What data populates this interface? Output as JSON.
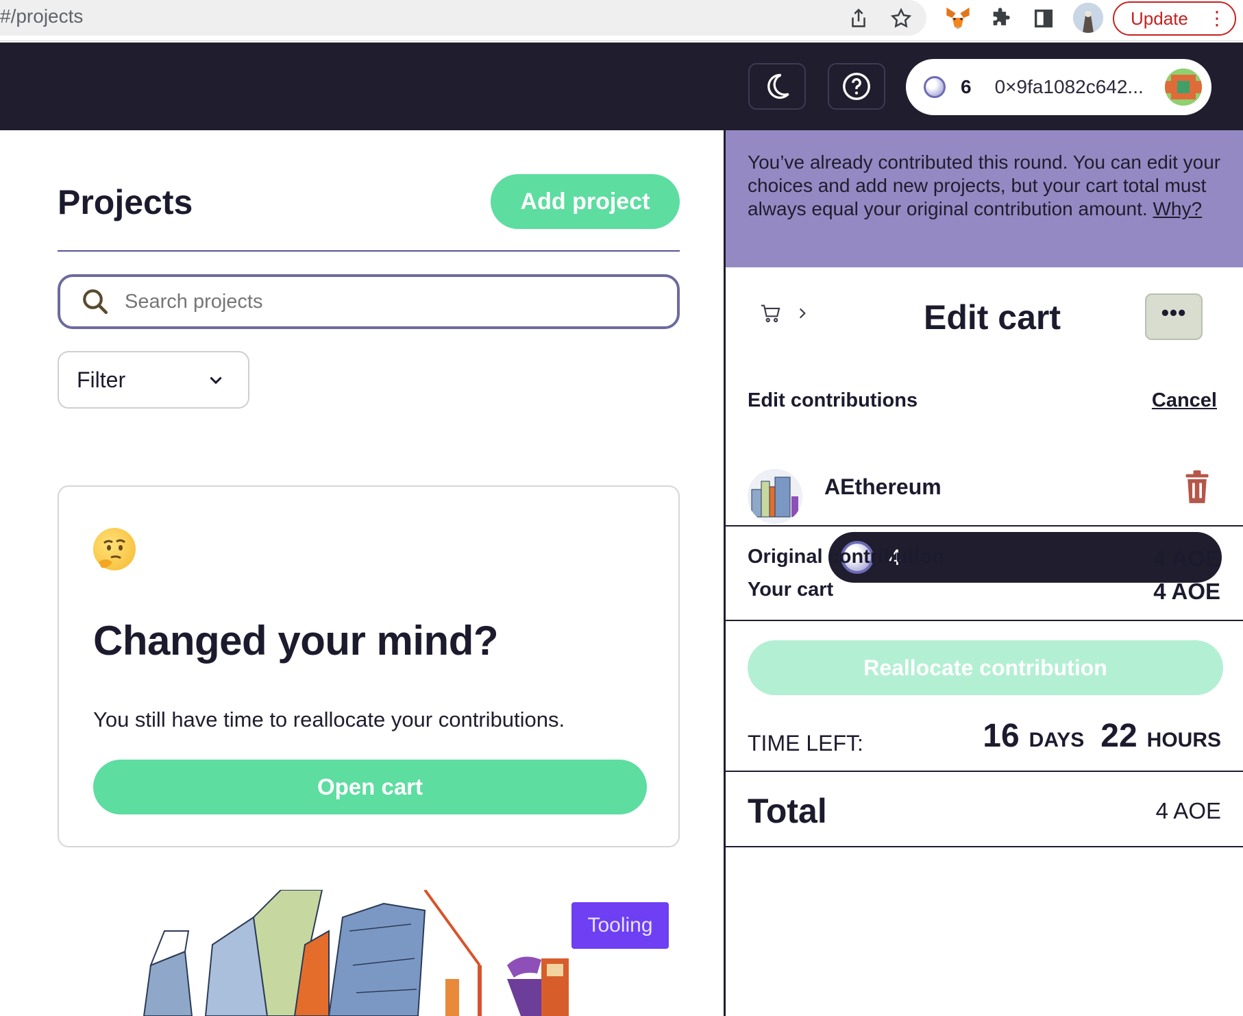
{
  "browser": {
    "url": "#/projects",
    "update_label": "Update",
    "update_menu_glyph": "⋮"
  },
  "header": {
    "wallet_balance": "6",
    "wallet_address": "0×9fa1082c642..."
  },
  "projects": {
    "title": "Projects",
    "add_project_label": "Add project",
    "search_placeholder": "Search projects",
    "filter_label": "Filter"
  },
  "mind_card": {
    "title": "Changed your mind?",
    "text": "You still have time to reallocate your contributions.",
    "open_cart_label": "Open cart"
  },
  "project_card": {
    "badge": "Tooling"
  },
  "cart": {
    "notice_text": "You’ve already contributed this round. You can edit your choices and add new projects, but your cart total must always equal your original contribution amount.",
    "notice_link": "Why?",
    "title": "Edit cart",
    "more_glyph": "•••",
    "edit_contributions_label": "Edit contributions",
    "cancel_label": "Cancel",
    "item": {
      "name": "AEthereum",
      "amount": "4"
    },
    "original_contribution_label": "Original contribution",
    "original_contribution_value": "4 AOE",
    "your_cart_label": "Your cart",
    "your_cart_value": "4 AOE",
    "reallocate_label": "Reallocate contribution",
    "time_left_label": "TIME LEFT:",
    "days": "16",
    "days_unit": "DAYS",
    "hours": "22",
    "hours_unit": "HOURS",
    "total_label": "Total",
    "total_value": "4 AOE"
  },
  "colors": {
    "header_bg": "#1f1d2e",
    "accent_green": "#5ddda0",
    "notice_purple": "#9589c3",
    "badge_purple": "#6e3ff3",
    "trash_red": "#b5564a"
  }
}
